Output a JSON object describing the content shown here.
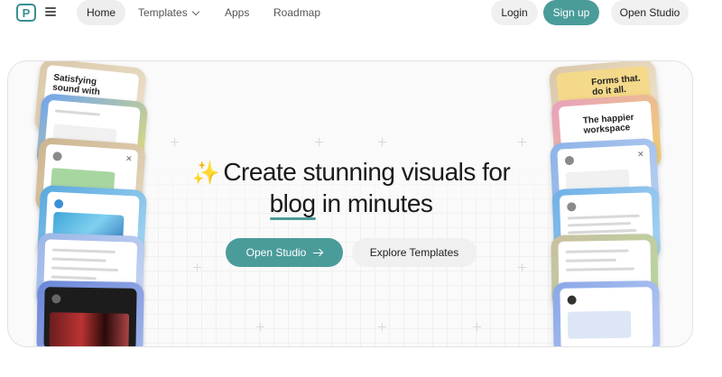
{
  "nav": {
    "home": "Home",
    "templates": "Templates",
    "apps": "Apps",
    "roadmap": "Roadmap",
    "login": "Login",
    "signup": "Sign up",
    "open_studio": "Open Studio"
  },
  "hero": {
    "headline_line1": "Create stunning visuals for",
    "headline_word": "blog",
    "headline_line2_rest": " in minutes",
    "sparkle": "✨",
    "primary_button": "Open Studio",
    "secondary_button": "Explore Templates"
  },
  "cards": {
    "left_top_text": "Satisfying sound with every keys",
    "right_top_text": "Forms that. do it all.",
    "right_second_text": "The happier workspace"
  },
  "colors": {
    "accent": "#4a9c9a",
    "sparkle": "#f2b63a"
  }
}
